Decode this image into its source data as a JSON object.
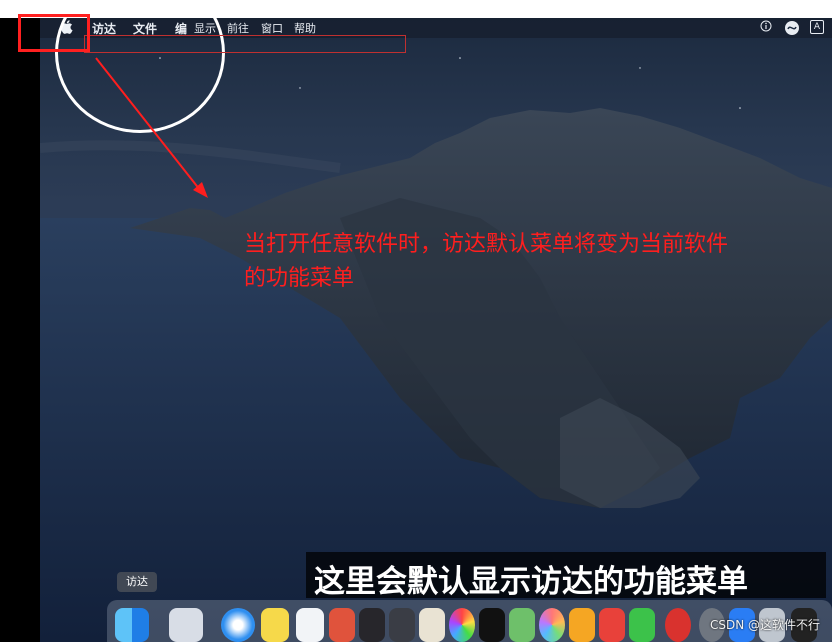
{
  "menubar": {
    "apple_menu": "apple-logo-icon",
    "items": [
      "访达",
      "文件",
      "编",
      "显示",
      "前往",
      "窗口",
      "帮助"
    ],
    "status_icons": [
      "info-icon",
      "siri-icon",
      "input-a-icon"
    ],
    "input_label": "A"
  },
  "annotation": {
    "line1": "当打开任意软件时，访达默认菜单将变为当前软件",
    "line2": "的功能菜单"
  },
  "caption": "这里会默认显示访达的功能菜单",
  "dock": {
    "tooltip": "访达",
    "icons": [
      "finder-icon",
      "launchpad-icon",
      "safari-icon",
      "notes-icon",
      "calendar-icon",
      "mail-icon",
      "video-icon",
      "music-icon",
      "pages-icon",
      "color-icon",
      "capcut-icon",
      "maps-icon",
      "photos-icon",
      "app-icon",
      "wps-icon",
      "wechat-icon",
      "netease-music-icon",
      "settings-icon",
      "app-store-icon",
      "preview-icon",
      "terminal-icon"
    ]
  },
  "watermark": "CSDN @这软件不行",
  "colors": {
    "annotation": "#ff1e1e",
    "highlight": "#ff2020",
    "caption_bg": "#000000"
  }
}
